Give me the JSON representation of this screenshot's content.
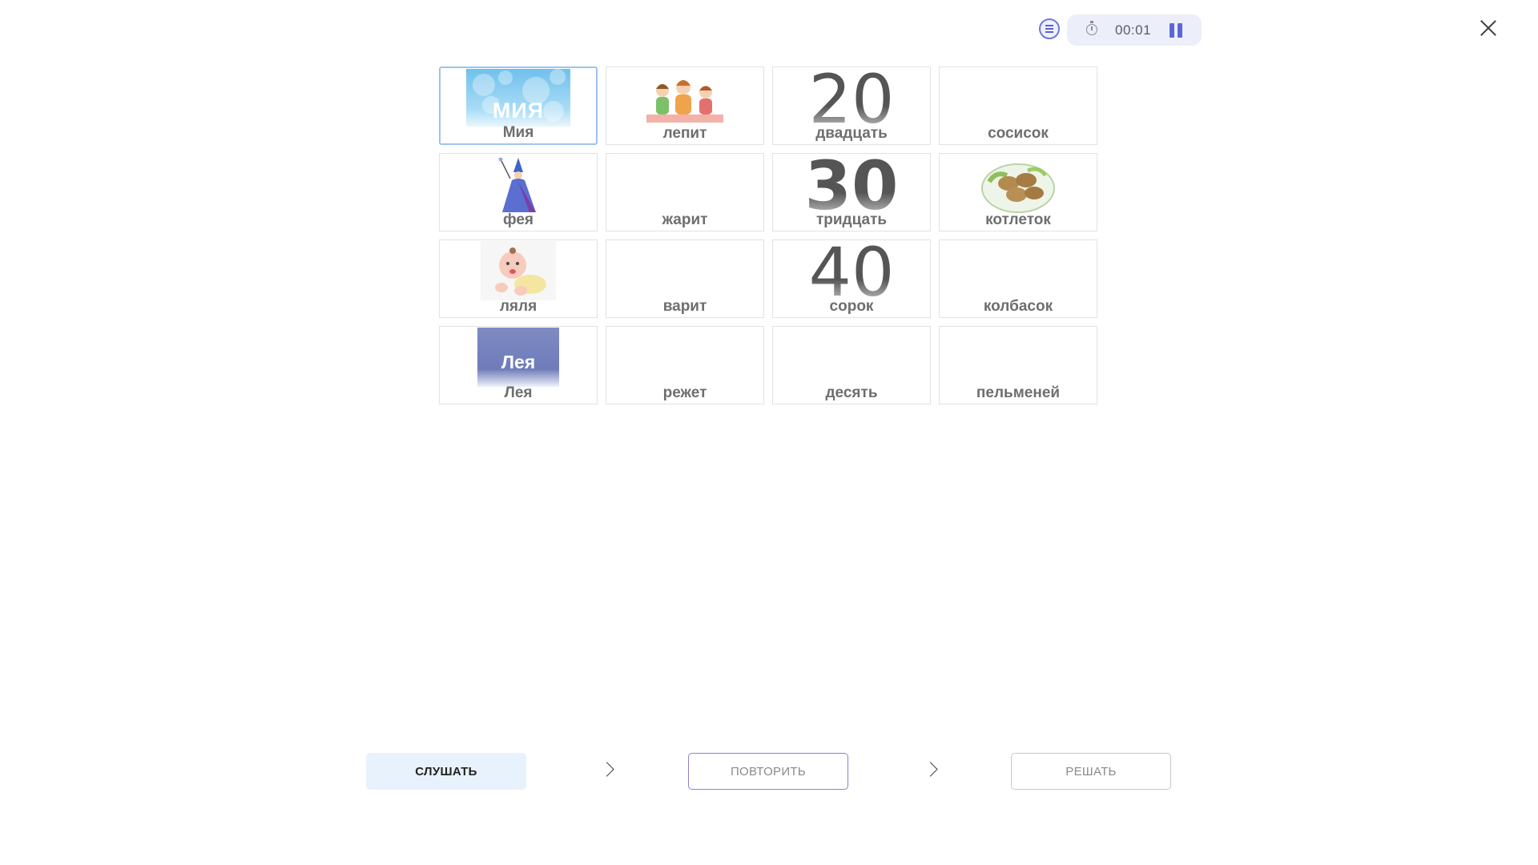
{
  "header": {
    "menu_icon": "list-icon",
    "timer": "00:01",
    "stopwatch_icon": "stopwatch-icon",
    "pause_icon": "pause-icon",
    "close_icon": "close-icon"
  },
  "cards": [
    {
      "label": "Мия",
      "picture": "bubbles-word-picture",
      "picture_text": "МИЯ"
    },
    {
      "label": "лепит",
      "picture": "mother-and-kids-sculpting-picture"
    },
    {
      "label": "двадцать",
      "picture": "number-picture",
      "picture_text": "20"
    },
    {
      "label": "сосисок",
      "picture": "none"
    },
    {
      "label": "фея",
      "picture": "fairy-picture"
    },
    {
      "label": "жарит",
      "picture": "none"
    },
    {
      "label": "тридцать",
      "picture": "number-picture",
      "picture_text": "30"
    },
    {
      "label": "котлеток",
      "picture": "cutlets-on-plate-picture"
    },
    {
      "label": "ляля",
      "picture": "baby-picture"
    },
    {
      "label": "варит",
      "picture": "none"
    },
    {
      "label": "сорок",
      "picture": "number-picture",
      "picture_text": "40"
    },
    {
      "label": "колбасок",
      "picture": "none"
    },
    {
      "label": "Лея",
      "picture": "name-card-picture",
      "picture_text": "Лея"
    },
    {
      "label": "режет",
      "picture": "none"
    },
    {
      "label": "десять",
      "picture": "none"
    },
    {
      "label": "пельменей",
      "picture": "none"
    }
  ],
  "steps": {
    "listen": "СЛУШАТЬ",
    "repeat": "ПОВТОРИТЬ",
    "solve": "РЕШАТЬ",
    "arrow_icon": "chevron-right-icon"
  },
  "colors": {
    "accent": "#5d66d6",
    "selected_border": "#9ec4ef",
    "listen_bg": "#e8f2fd",
    "repeat_border": "#8b7fd6"
  }
}
